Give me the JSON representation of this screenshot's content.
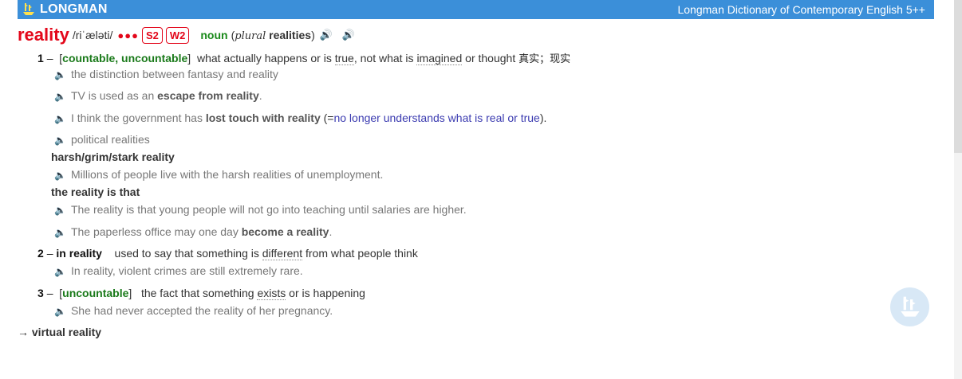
{
  "header": {
    "brand": "LONGMAN",
    "dictionary_title": "Longman Dictionary of Contemporary English 5++"
  },
  "entry": {
    "headword": "reality",
    "pronunciation": "/riˈæləti/",
    "frequency_dots": "●●●",
    "badges": [
      "S2",
      "W2"
    ],
    "pos": "noun",
    "plural_open": "(",
    "plural_label": "plural",
    "plural_form": "realities",
    "plural_close": ")"
  },
  "senses": [
    {
      "number": "1",
      "dash": "–",
      "grammar": "countable, uncountable",
      "definition_parts": [
        "what actually happens or is ",
        "true",
        ", not what is ",
        "imagined",
        " or thought "
      ],
      "chinese": "真实；现实",
      "examples": [
        {
          "pre": "the distinction between fantasy and reality"
        },
        {
          "pre": "TV is used as an ",
          "bold": "escape from reality",
          "post": "."
        },
        {
          "pre": "I think the government has ",
          "bold": "lost touch with reality",
          "post": " (=",
          "gloss": "no longer understands what is real or true",
          "post2": ")."
        },
        {
          "pre": "political realities"
        }
      ],
      "collocations": [
        {
          "phrase": "harsh/grim/stark reality",
          "example": "Millions of people live with the harsh realities of unemployment."
        },
        {
          "phrase": "the reality is that",
          "example": "The reality is that young people will not go into teaching until salaries are higher."
        }
      ],
      "extra_example": {
        "pre": "The paperless office may one day ",
        "bold": "become a reality",
        "post": "."
      }
    },
    {
      "number": "2",
      "dash": "–",
      "phrase": "in reality",
      "definition_parts": [
        "used to say that something is ",
        "different",
        " from what people think"
      ],
      "examples": [
        {
          "pre": "In reality, violent crimes are still extremely rare."
        }
      ]
    },
    {
      "number": "3",
      "dash": "–",
      "grammar": "uncountable",
      "definition_parts": [
        "the fact that something ",
        "exists",
        " or is happening"
      ],
      "examples": [
        {
          "pre": "She had never accepted the reality of her pregnancy."
        }
      ]
    }
  ],
  "cross_reference": {
    "arrow": "→",
    "text": "virtual reality"
  },
  "icons": {
    "speaker": "speaker-icon",
    "logo": "ship-logo-icon"
  },
  "colors": {
    "topbar": "#3b8fd9",
    "headword": "#e3071a",
    "grammar": "#1a7a1a",
    "gloss": "#3b3bb0"
  }
}
